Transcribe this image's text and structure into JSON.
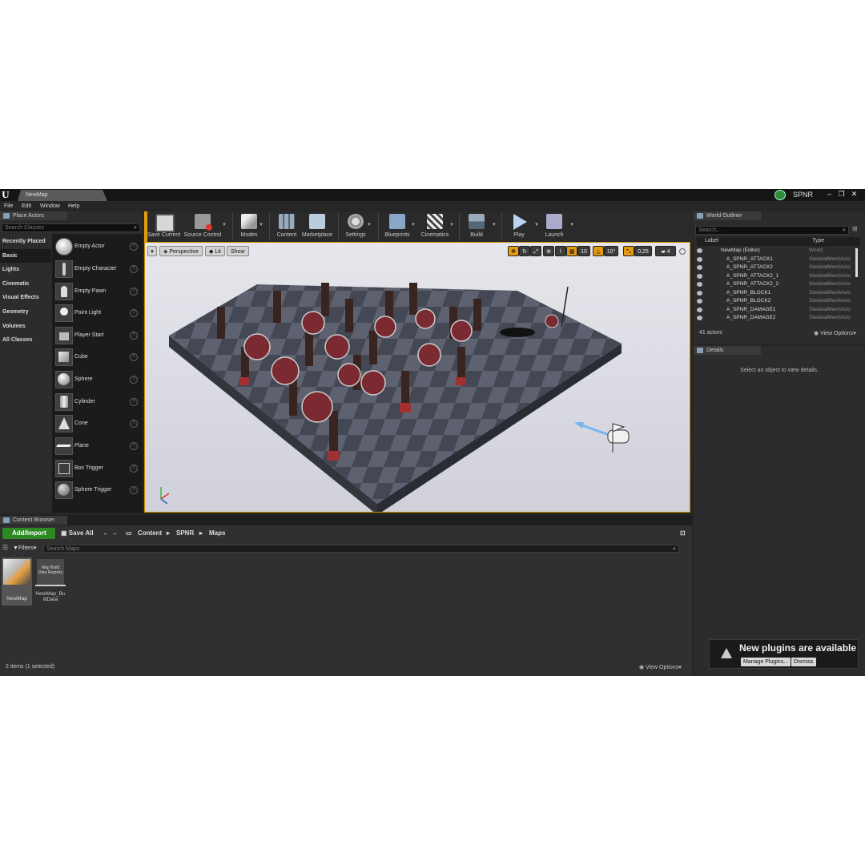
{
  "window": {
    "map_tab": "NewMap",
    "project_name": "SPNR",
    "controls": [
      "–",
      "❐",
      "✕"
    ]
  },
  "menu": [
    "File",
    "Edit",
    "Window",
    "Help"
  ],
  "place_actors": {
    "tab_title": "Place Actors",
    "search_placeholder": "Search Classes",
    "categories": [
      "Recently Placed",
      "Basic",
      "Lights",
      "Cinematic",
      "Visual Effects",
      "Geometry",
      "Volumes",
      "All Classes"
    ],
    "active_category": "Basic",
    "items": [
      "Empty Actor",
      "Empty Character",
      "Empty Pawn",
      "Point Light",
      "Player Start",
      "Cube",
      "Sphere",
      "Cylinder",
      "Cone",
      "Plane",
      "Box Trigger",
      "Sphere Trigger"
    ]
  },
  "toolbar": {
    "buttons": [
      "Save Current",
      "Source Control",
      "Modes",
      "Content",
      "Marketplace",
      "Settings",
      "Blueprints",
      "Cinematics",
      "Build",
      "Play",
      "Launch"
    ]
  },
  "viewport": {
    "view_mode": "Perspective",
    "lighting": "Lit",
    "show": "Show",
    "grid_snap": "10",
    "rotation_snap": "10°",
    "scale_snap": "0,25",
    "camera_speed": "4"
  },
  "outliner": {
    "tab_title": "World Outliner",
    "search_placeholder": "Search...",
    "col_label": "Label",
    "col_type": "Type",
    "rows": [
      {
        "label": "NewMap (Editor)",
        "type": "World"
      },
      {
        "label": "A_SPNR_ATTACK1",
        "type": "SkeletalMeshActo"
      },
      {
        "label": "A_SPNR_ATTACK2",
        "type": "SkeletalMeshActo"
      },
      {
        "label": "A_SPNR_ATTACK2_1",
        "type": "SkeletalMeshActo"
      },
      {
        "label": "A_SPNR_ATTACK2_2",
        "type": "SkeletalMeshActo"
      },
      {
        "label": "A_SPNR_BLOCK1",
        "type": "SkeletalMeshActo"
      },
      {
        "label": "A_SPNR_BLOCK2",
        "type": "SkeletalMeshActo"
      },
      {
        "label": "A_SPNR_DAMAGE1",
        "type": "SkeletalMeshActo"
      },
      {
        "label": "A_SPNR_DAMAGE2",
        "type": "SkeletalMeshActo"
      }
    ],
    "actor_count": "41 actors",
    "view_options": "View Options"
  },
  "details": {
    "tab_title": "Details",
    "empty_message": "Select an object to view details."
  },
  "content_browser": {
    "tab_title": "Content Browser",
    "add_import": "Add/Import",
    "save_all": "Save All",
    "path": [
      "Content",
      "SPNR",
      "Maps"
    ],
    "filters": "Filters",
    "search_placeholder": "Search Maps",
    "assets": [
      {
        "name": "NewMap",
        "thumb_text": ""
      },
      {
        "name": "NewMap_BuiltData",
        "thumb_text": "Map Build Data Registry"
      }
    ],
    "status": "2 items (1 selected)",
    "view_options": "View Options"
  },
  "notification": {
    "title": "New plugins are available",
    "manage": "Manage Plugins...",
    "dismiss": "Dismiss"
  },
  "colors": {
    "accent_orange": "#e59a10",
    "add_green": "#2d8a22",
    "panel_bg": "#2c2c2c"
  }
}
